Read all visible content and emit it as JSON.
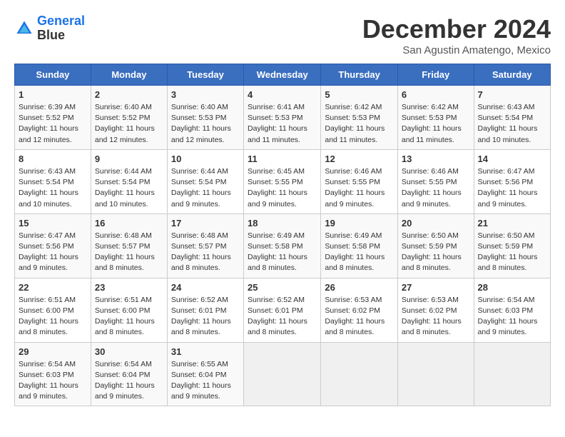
{
  "header": {
    "logo_line1": "General",
    "logo_line2": "Blue",
    "month_title": "December 2024",
    "subtitle": "San Agustin Amatengo, Mexico"
  },
  "days_of_week": [
    "Sunday",
    "Monday",
    "Tuesday",
    "Wednesday",
    "Thursday",
    "Friday",
    "Saturday"
  ],
  "weeks": [
    [
      {
        "day": "1",
        "text": "Sunrise: 6:39 AM\nSunset: 5:52 PM\nDaylight: 11 hours and 12 minutes."
      },
      {
        "day": "2",
        "text": "Sunrise: 6:40 AM\nSunset: 5:52 PM\nDaylight: 11 hours and 12 minutes."
      },
      {
        "day": "3",
        "text": "Sunrise: 6:40 AM\nSunset: 5:53 PM\nDaylight: 11 hours and 12 minutes."
      },
      {
        "day": "4",
        "text": "Sunrise: 6:41 AM\nSunset: 5:53 PM\nDaylight: 11 hours and 11 minutes."
      },
      {
        "day": "5",
        "text": "Sunrise: 6:42 AM\nSunset: 5:53 PM\nDaylight: 11 hours and 11 minutes."
      },
      {
        "day": "6",
        "text": "Sunrise: 6:42 AM\nSunset: 5:53 PM\nDaylight: 11 hours and 11 minutes."
      },
      {
        "day": "7",
        "text": "Sunrise: 6:43 AM\nSunset: 5:54 PM\nDaylight: 11 hours and 10 minutes."
      }
    ],
    [
      {
        "day": "8",
        "text": "Sunrise: 6:43 AM\nSunset: 5:54 PM\nDaylight: 11 hours and 10 minutes."
      },
      {
        "day": "9",
        "text": "Sunrise: 6:44 AM\nSunset: 5:54 PM\nDaylight: 11 hours and 10 minutes."
      },
      {
        "day": "10",
        "text": "Sunrise: 6:44 AM\nSunset: 5:54 PM\nDaylight: 11 hours and 9 minutes."
      },
      {
        "day": "11",
        "text": "Sunrise: 6:45 AM\nSunset: 5:55 PM\nDaylight: 11 hours and 9 minutes."
      },
      {
        "day": "12",
        "text": "Sunrise: 6:46 AM\nSunset: 5:55 PM\nDaylight: 11 hours and 9 minutes."
      },
      {
        "day": "13",
        "text": "Sunrise: 6:46 AM\nSunset: 5:55 PM\nDaylight: 11 hours and 9 minutes."
      },
      {
        "day": "14",
        "text": "Sunrise: 6:47 AM\nSunset: 5:56 PM\nDaylight: 11 hours and 9 minutes."
      }
    ],
    [
      {
        "day": "15",
        "text": "Sunrise: 6:47 AM\nSunset: 5:56 PM\nDaylight: 11 hours and 9 minutes."
      },
      {
        "day": "16",
        "text": "Sunrise: 6:48 AM\nSunset: 5:57 PM\nDaylight: 11 hours and 8 minutes."
      },
      {
        "day": "17",
        "text": "Sunrise: 6:48 AM\nSunset: 5:57 PM\nDaylight: 11 hours and 8 minutes."
      },
      {
        "day": "18",
        "text": "Sunrise: 6:49 AM\nSunset: 5:58 PM\nDaylight: 11 hours and 8 minutes."
      },
      {
        "day": "19",
        "text": "Sunrise: 6:49 AM\nSunset: 5:58 PM\nDaylight: 11 hours and 8 minutes."
      },
      {
        "day": "20",
        "text": "Sunrise: 6:50 AM\nSunset: 5:59 PM\nDaylight: 11 hours and 8 minutes."
      },
      {
        "day": "21",
        "text": "Sunrise: 6:50 AM\nSunset: 5:59 PM\nDaylight: 11 hours and 8 minutes."
      }
    ],
    [
      {
        "day": "22",
        "text": "Sunrise: 6:51 AM\nSunset: 6:00 PM\nDaylight: 11 hours and 8 minutes."
      },
      {
        "day": "23",
        "text": "Sunrise: 6:51 AM\nSunset: 6:00 PM\nDaylight: 11 hours and 8 minutes."
      },
      {
        "day": "24",
        "text": "Sunrise: 6:52 AM\nSunset: 6:01 PM\nDaylight: 11 hours and 8 minutes."
      },
      {
        "day": "25",
        "text": "Sunrise: 6:52 AM\nSunset: 6:01 PM\nDaylight: 11 hours and 8 minutes."
      },
      {
        "day": "26",
        "text": "Sunrise: 6:53 AM\nSunset: 6:02 PM\nDaylight: 11 hours and 8 minutes."
      },
      {
        "day": "27",
        "text": "Sunrise: 6:53 AM\nSunset: 6:02 PM\nDaylight: 11 hours and 8 minutes."
      },
      {
        "day": "28",
        "text": "Sunrise: 6:54 AM\nSunset: 6:03 PM\nDaylight: 11 hours and 9 minutes."
      }
    ],
    [
      {
        "day": "29",
        "text": "Sunrise: 6:54 AM\nSunset: 6:03 PM\nDaylight: 11 hours and 9 minutes."
      },
      {
        "day": "30",
        "text": "Sunrise: 6:54 AM\nSunset: 6:04 PM\nDaylight: 11 hours and 9 minutes."
      },
      {
        "day": "31",
        "text": "Sunrise: 6:55 AM\nSunset: 6:04 PM\nDaylight: 11 hours and 9 minutes."
      },
      {
        "day": "",
        "text": ""
      },
      {
        "day": "",
        "text": ""
      },
      {
        "day": "",
        "text": ""
      },
      {
        "day": "",
        "text": ""
      }
    ]
  ]
}
